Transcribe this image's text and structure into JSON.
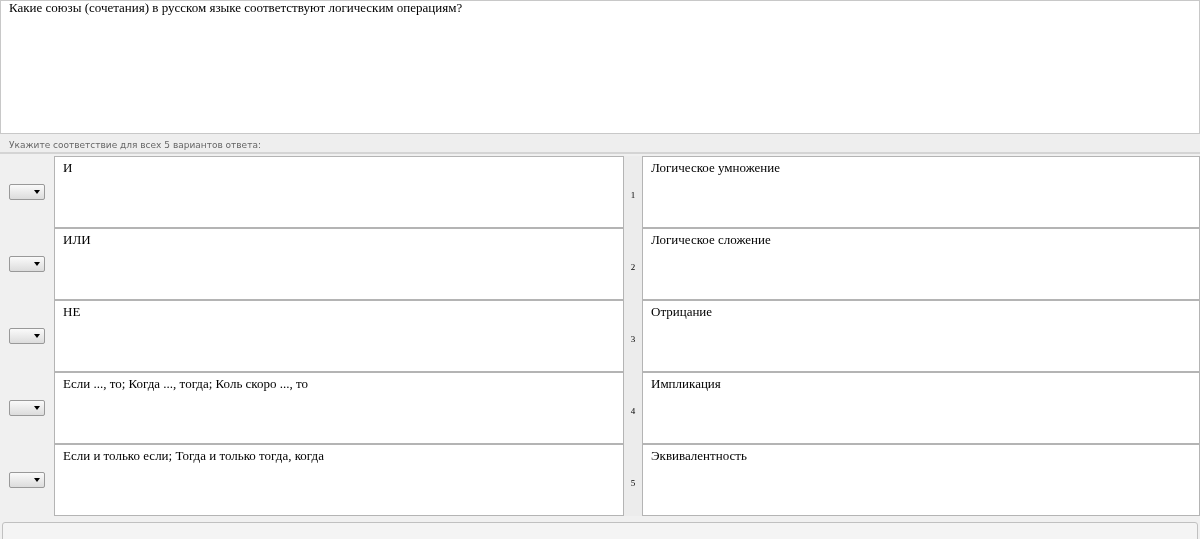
{
  "question": "Какие союзы (сочетания) в русском языке соответствуют логическим операциям?",
  "instruction": "Укажите соответствие для всех 5 вариантов ответа:",
  "rows": [
    {
      "left": "И",
      "number": "1",
      "right": "Логическое умножение"
    },
    {
      "left": "ИЛИ",
      "number": "2",
      "right": "Логическое сложение"
    },
    {
      "left": "НЕ",
      "number": "3",
      "right": "Отрицание"
    },
    {
      "left": "Если ..., то; Когда ..., тогда; Коль скоро ..., то",
      "number": "4",
      "right": "Импликация"
    },
    {
      "left": "Если и только если; Тогда и только тогда, когда",
      "number": "5",
      "right": "Эквивалентность"
    }
  ]
}
